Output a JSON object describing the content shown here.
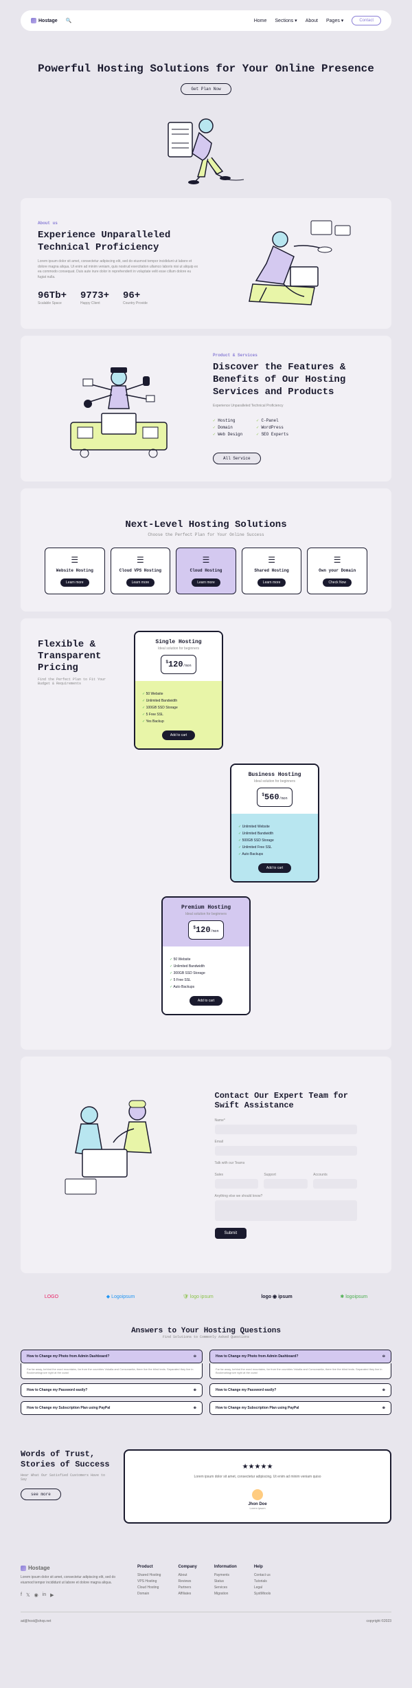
{
  "nav": {
    "brand": "Hostage",
    "items": [
      "Home",
      "Sections ▾",
      "About",
      "Pages ▾"
    ],
    "contact": "Contact"
  },
  "hero": {
    "title": "Powerful Hosting Solutions for Your Online Presence",
    "cta": "Get Plan Now"
  },
  "about": {
    "eyebrow": "About us",
    "title": "Experience Unparalleled Technical Proficiency",
    "body": "Lorem ipsum dolor sit amet, consectetur adipiscing elit, sed do eiusmod tempor incididunt ut labore et dolore magna aliqua. Ut enim ad minim veniam, quis nostrud exercitation ullamco laboris nisi ut aliquip ex ea commodo consequat. Duis aute irure dolor in reprehenderit in voluptate velit esse cillum dolore eu fugiat nulla.",
    "stats": [
      {
        "num": "96Tb+",
        "lbl": "Scalable Space"
      },
      {
        "num": "9773+",
        "lbl": "Happy Client"
      },
      {
        "num": "96+",
        "lbl": "Country Provide"
      }
    ]
  },
  "products": {
    "eyebrow": "Product & Services",
    "title": "Discover the Features & Benefits of Our Hosting Services and Products",
    "sub": "Experience Unparalleled Technical Proficiency",
    "col1": [
      "Hosting",
      "Domain",
      "Web Design"
    ],
    "col2": [
      "C-Panel",
      "WordPress",
      "SEO Experts"
    ],
    "cta": "All Service"
  },
  "hosting": {
    "title": "Next-Level Hosting Solutions",
    "sub": "Choose the Perfect Plan for Your Online Success",
    "cards": [
      {
        "name": "Website Hosting",
        "btn": "Learn more"
      },
      {
        "name": "Cloud VPS Hosting",
        "btn": "Learn more"
      },
      {
        "name": "Cloud Hosting",
        "btn": "Learn more",
        "active": true
      },
      {
        "name": "Shared Hosting",
        "btn": "Learn more"
      },
      {
        "name": "Own your Domain",
        "btn": "Check Now"
      }
    ]
  },
  "pricing": {
    "title": "Flexible & Transparent Pricing",
    "sub": "Find the Perfect Plan to Fit Your Budget & Requirements",
    "plans": [
      {
        "name": "Single Hosting",
        "sub": "Ideal solution for beginners",
        "price": "120",
        "period": "/mon",
        "feat": [
          "50 Website",
          "Unlimited Bandwidth",
          "100GB SSD Storage",
          "5 Free SSL",
          "Yes Backup"
        ],
        "cls": "plan-single"
      },
      {
        "name": "Business Hosting",
        "sub": "Ideal solution for beginners",
        "price": "560",
        "period": "/mon",
        "feat": [
          "Unlimited Website",
          "Unlimited Bandwidth",
          "500GB SSD Storage",
          "Unlimited Free SSL",
          "Auto Backups"
        ],
        "cls": "plan-biz"
      },
      {
        "name": "Premium Hosting",
        "sub": "Ideal solution for beginners",
        "price": "120",
        "period": "/mon",
        "feat": [
          "50 Website",
          "Unlimited Bandwidth",
          "300GB SSD Storage",
          "5 Free SSL",
          "Auto Backups"
        ],
        "cls": "plan-prem"
      }
    ],
    "cart": "Add to cart"
  },
  "contact": {
    "title": "Contact Our Expert Team for Swift Assistance",
    "fields": {
      "name": "Name*",
      "email": "Email",
      "team": "Talk with our Teams",
      "sales": "Sales",
      "support": "Support",
      "accounts": "Accounts",
      "message": "Anything else we should know?"
    },
    "submit": "Submit"
  },
  "logos": [
    "LOGO",
    "◆ Logoipsum",
    "🛡 logo ipsum",
    "logo ◉ ipsum",
    "✱ logoipsum"
  ],
  "faq": {
    "title": "Answers to Your Hosting Questions",
    "sub": "Find Solutions to Commonly Asked Questions",
    "left": [
      {
        "q": "How to Change my Photo from Admin Dashboard?",
        "open": true,
        "a": "Far far away, behind the word mountains, far from the countries Vokalia and Consonantia, there live the blind texts. Separated they live in Bookmarksgrove right at the coast"
      },
      {
        "q": "How to Change my Password easily?"
      },
      {
        "q": "How to Change my Subscription Plan using PayPal"
      }
    ],
    "right": [
      {
        "q": "How to Change my Photo from Admin Dashboard?",
        "open": true,
        "a": "Far far away, behind the word mountains, far from the countries Vokalia and Consonantia, there live the blind texts. Separated they live in Bookmarksgrove right at the coast"
      },
      {
        "q": "How to Change my Password easily?"
      },
      {
        "q": "How to Change my Subscription Plan using PayPal"
      }
    ]
  },
  "testimonial": {
    "title": "Words of Trust, Stories of Success",
    "sub": "Hear What Our Satisfied Customers Have to Say",
    "cta": "see more",
    "stars": "★★★★★",
    "body": "Lorem ipsum dolor sit amet, consectetur adipiscing. Ut enim ad minim veniam quiso",
    "author": "Jhon Doe",
    "role": "Lorem ipsum"
  },
  "footer": {
    "brand": "Hostage",
    "desc": "Lorem ipsum dolor sit amet, consectetur adipiscing elit, sed do eiusmod tempor incididunt ut labore et dolore magna aliqua.",
    "cols": [
      {
        "h": "Product",
        "items": [
          "Shared Hosting",
          "VPS Hosting",
          "Cloud Hosting",
          "Domain"
        ]
      },
      {
        "h": "Company",
        "items": [
          "About",
          "Reviews",
          "Partners",
          "Affiliates"
        ]
      },
      {
        "h": "Information",
        "items": [
          "Payments",
          "Status",
          "Services",
          "Migration"
        ]
      },
      {
        "h": "Help",
        "items": [
          "Contact us",
          "Tutorials",
          "Legal",
          "SystMtools"
        ]
      }
    ],
    "email": "ad@host@shop.net",
    "copy": "copyright ©2023"
  }
}
